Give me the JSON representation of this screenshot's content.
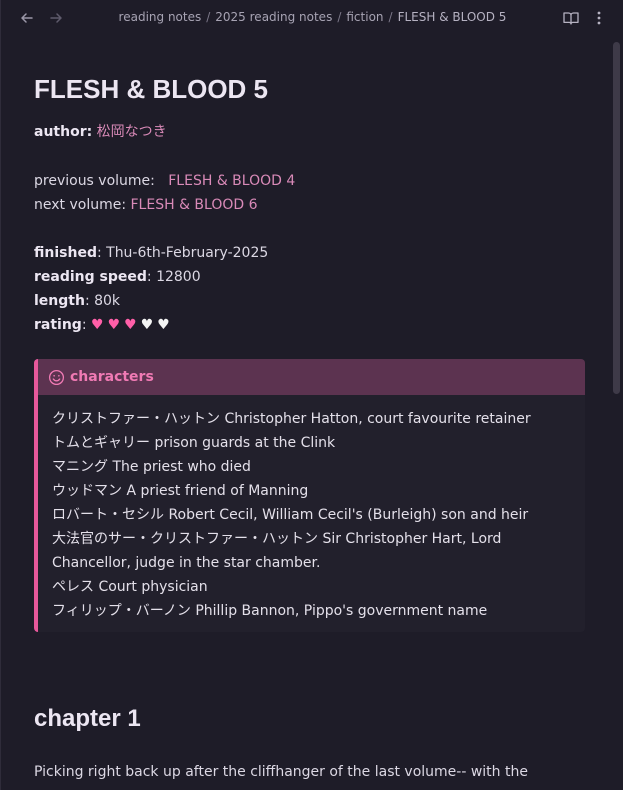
{
  "breadcrumb": [
    "reading notes",
    "2025 reading notes",
    "fiction",
    "FLESH & BLOOD 5"
  ],
  "title": "FLESH & BLOOD 5",
  "author": {
    "label": "author:",
    "value": "松岡なつき"
  },
  "previous": {
    "label": "previous volume:",
    "value": "FLESH & BLOOD 4"
  },
  "next": {
    "label": "next volume:",
    "value": "FLESH & BLOOD 6"
  },
  "finished": {
    "label": "finished",
    "value": ": Thu-6th-February-2025"
  },
  "speed": {
    "label": "reading speed",
    "value": ": 12800"
  },
  "length": {
    "label": "length",
    "value": ": 80k"
  },
  "rating": {
    "label": "rating",
    "sep": ": ",
    "filled": 3,
    "total": 5
  },
  "callout": {
    "title": "characters",
    "lines": [
      "クリストファー・ハットン Christopher Hatton, court favourite retainer",
      "トムとギャリー prison guards at the Clink",
      "マニング The priest who died",
      "ウッドマン A priest friend of Manning",
      "ロバート・セシル Robert Cecil, William Cecil's (Burleigh) son and heir",
      "大法官のサー・クリストファー・ハットン Sir Christopher Hart, Lord",
      "Chancellor, judge in the star chamber.",
      "ペレス Court physician",
      "フィリップ・バーノン Phillip Bannon, Pippo's government name"
    ]
  },
  "chapter": "chapter 1",
  "paragraph": "Picking right back up after the cliffhanger of the last volume-- with the",
  "colors": {
    "accent": "#e6589b",
    "link": "#d98ab8",
    "background": "#1e1c28",
    "callout_header": "#5c3350"
  }
}
